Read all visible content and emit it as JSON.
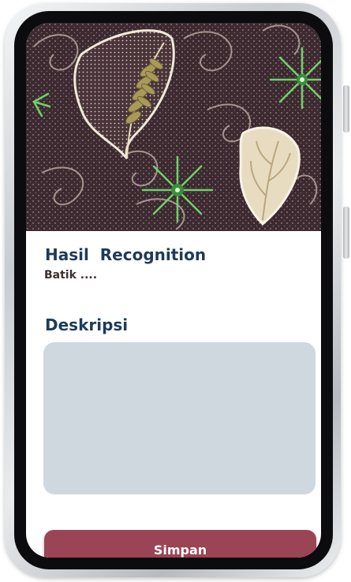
{
  "colors": {
    "accent_button": "#9b4455",
    "heading": "#1d3b5a",
    "description_box": "#d0d8df",
    "batik_background": "#3d2a30",
    "batik_leaf_green": "#6fd16a",
    "batik_leaf_cream": "#e8dcc0"
  },
  "hero": {
    "image": "batik-pattern-photo"
  },
  "result": {
    "title": "Hasil  Recognition",
    "value": "Batik ...."
  },
  "description": {
    "title": "Deskripsi",
    "value": ""
  },
  "actions": {
    "save_label": "Simpan"
  }
}
